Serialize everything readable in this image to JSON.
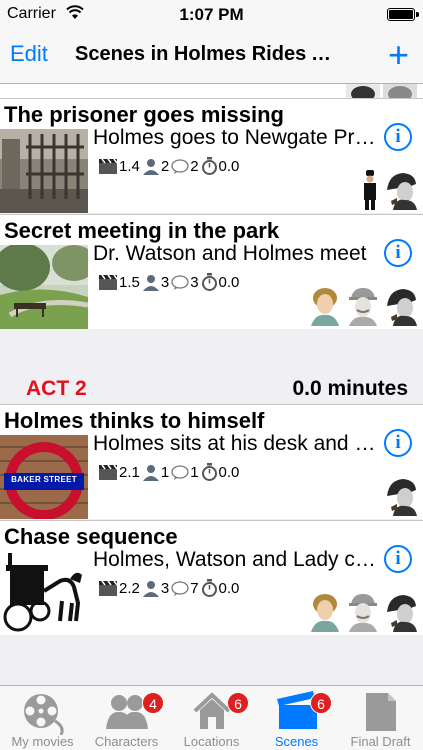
{
  "status_bar": {
    "carrier": "Carrier",
    "time": "1:07 PM"
  },
  "nav": {
    "edit_label": "Edit",
    "title": "Scenes in Holmes Rides Again",
    "add_label": "+"
  },
  "scenes": [
    {
      "title": "The prisoner goes missing",
      "summary": "Holmes goes to Newgate Prison",
      "scene_num": "1.4",
      "characters": "2",
      "dialog": "2",
      "minutes": "0.0"
    },
    {
      "title": "Secret meeting in the park",
      "summary": "Dr. Watson and Holmes meet",
      "scene_num": "1.5",
      "characters": "3",
      "dialog": "3",
      "minutes": "0.0"
    },
    {
      "title": "Holmes thinks to himself",
      "summary": "Holmes sits at his desk and thinks",
      "scene_num": "2.1",
      "characters": "1",
      "dialog": "1",
      "minutes": "0.0",
      "thumb_text": "BAKER STREET"
    },
    {
      "title": "Chase sequence",
      "summary": "Holmes, Watson and Lady chase",
      "scene_num": "2.2",
      "characters": "3",
      "dialog": "7",
      "minutes": "0.0"
    }
  ],
  "act": {
    "label": "ACT 2",
    "minutes": "0.0 minutes"
  },
  "tabs": [
    {
      "label": "My movies",
      "icon": "film-reel-icon",
      "badge": ""
    },
    {
      "label": "Characters",
      "icon": "characters-icon",
      "badge": "4"
    },
    {
      "label": "Locations",
      "icon": "house-icon",
      "badge": "6"
    },
    {
      "label": "Scenes",
      "icon": "clapperboard-icon",
      "badge": "6"
    },
    {
      "label": "Final Draft",
      "icon": "document-icon",
      "badge": ""
    }
  ],
  "colors": {
    "accent": "#007aff",
    "act_red": "#e0111e",
    "badge_red": "#e02020"
  }
}
